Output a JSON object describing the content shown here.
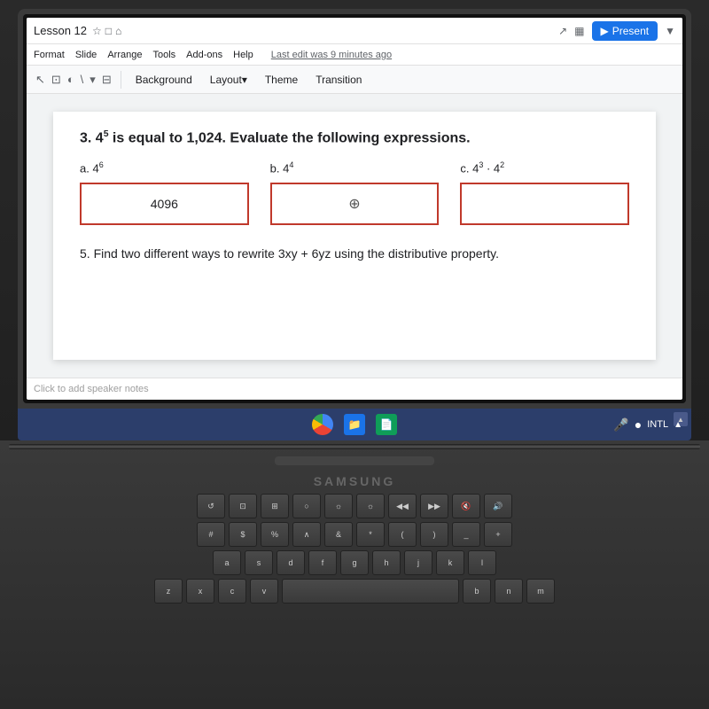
{
  "app": {
    "title": "Lesson 12",
    "last_edit": "Last edit was 9 minutes ago",
    "present_label": "Present"
  },
  "menu": {
    "items": [
      "Format",
      "Slide",
      "Arrange",
      "Tools",
      "Add-ons",
      "Help"
    ]
  },
  "toolbar": {
    "background_label": "Background",
    "layout_label": "Layout",
    "theme_label": "Theme",
    "transition_label": "Transition"
  },
  "slide": {
    "question3": {
      "intro": "3. 4⁵ is equal to 1,024. Evaluate the following expressions.",
      "expressions": [
        {
          "label": "a. 4⁶",
          "answer": "4096",
          "has_answer": true
        },
        {
          "label": "b. 4⁴",
          "answer": "",
          "has_answer": false,
          "cursor": true
        },
        {
          "label": "c. 4³ · 4²",
          "answer": "",
          "has_answer": false
        }
      ]
    },
    "question5": "5.  Find two different ways to rewrite 3xy + 6yz using the distributive property.",
    "speaker_notes": "Click to add speaker notes"
  },
  "taskbar": {
    "intl_label": "INTL"
  },
  "keyboard": {
    "brand": "SAMSUNG",
    "rows": [
      [
        "↺",
        "⊡",
        "⊞",
        "○",
        "☼",
        "☼",
        "◀◀",
        "▶▶",
        "🔇",
        "🔊"
      ],
      [
        "#",
        "$",
        "%",
        "∧",
        "&",
        "*",
        "(",
        ")",
        "_",
        "+"
      ],
      [
        "a",
        "s",
        "d",
        "f",
        "g",
        "h",
        "j",
        "k",
        "l"
      ],
      [
        "z",
        "x",
        "c",
        "v",
        "b",
        "n",
        "m"
      ]
    ]
  }
}
